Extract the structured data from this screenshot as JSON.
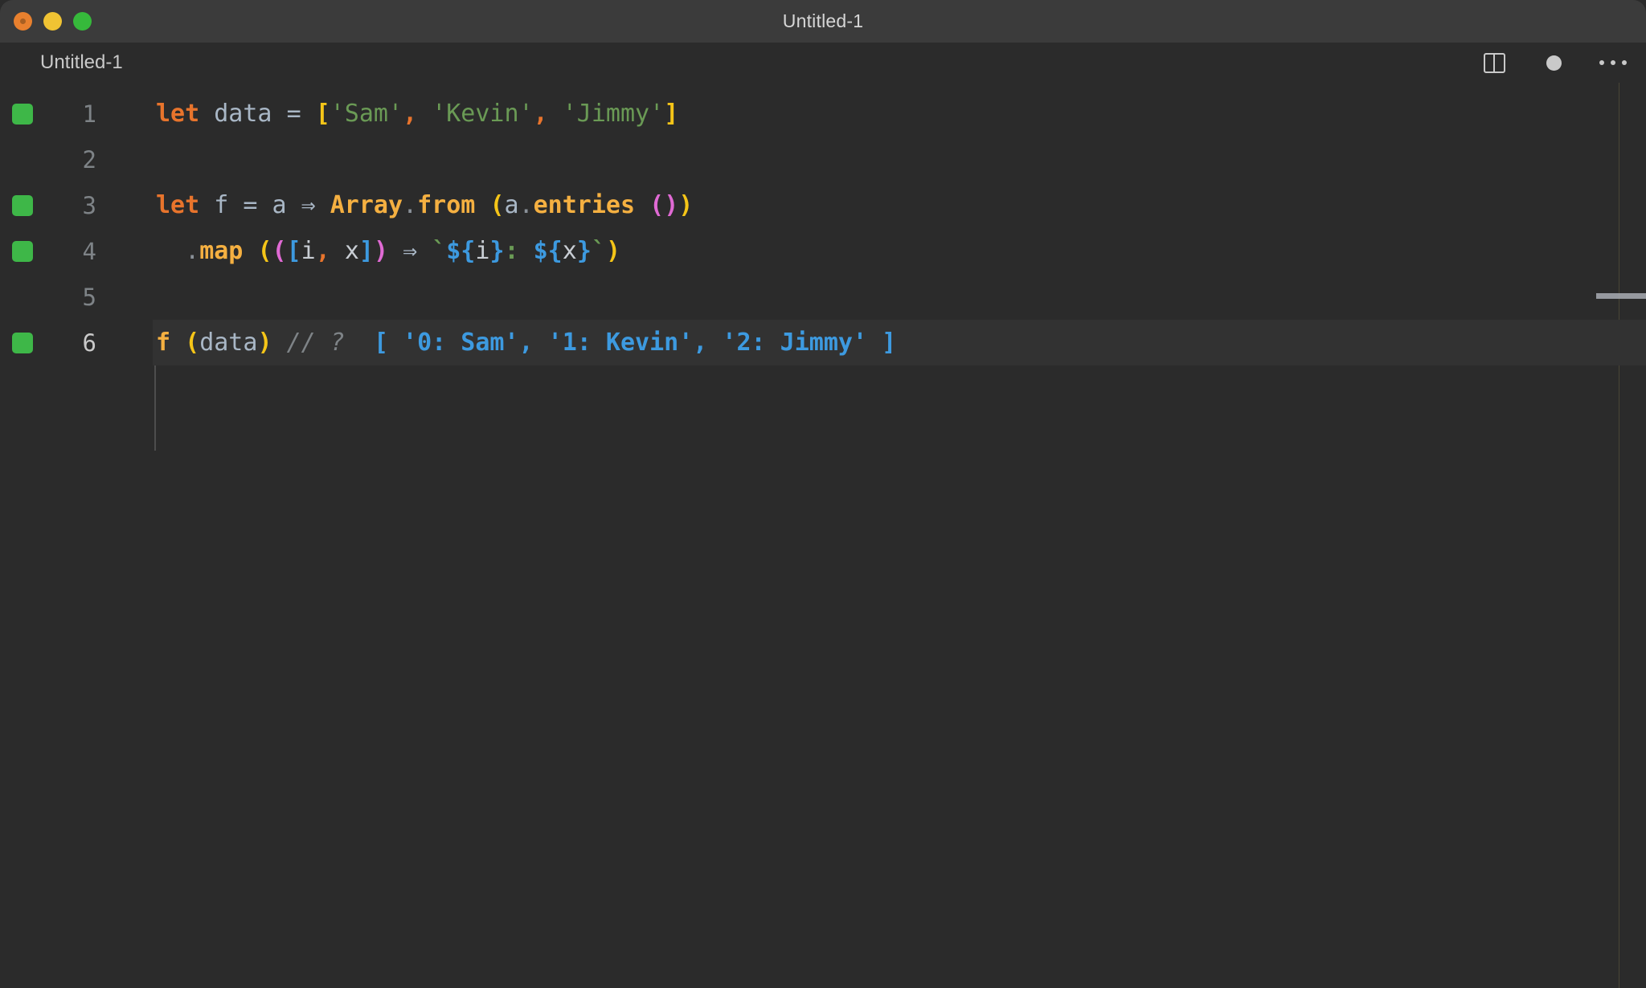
{
  "window": {
    "title": "Untitled-1",
    "traffic_lights": [
      {
        "name": "close",
        "color": "#e8802e"
      },
      {
        "name": "minimize",
        "color": "#f0c333"
      },
      {
        "name": "maximize",
        "color": "#36b93b"
      }
    ]
  },
  "tabstrip": {
    "tab_label": "Untitled-1",
    "actions": [
      {
        "icon": "split-editor-icon"
      },
      {
        "icon": "unsaved-dot-icon"
      },
      {
        "icon": "more-actions-ellipsis-icon"
      }
    ]
  },
  "editor": {
    "language": "javascript",
    "active_line": 6,
    "lines": [
      {
        "number": "1",
        "marker": true,
        "text": "let data = ['Sam', 'Kevin', 'Jimmy']",
        "tokens": [
          {
            "t": "let",
            "c": "t-kw"
          },
          {
            "t": " ",
            "c": "t-plain-w"
          },
          {
            "t": "data",
            "c": "t-var"
          },
          {
            "t": " ",
            "c": "t-plain-w"
          },
          {
            "t": "=",
            "c": "t-op"
          },
          {
            "t": " ",
            "c": "t-plain-w"
          },
          {
            "t": "[",
            "c": "t-punct-y"
          },
          {
            "t": "'Sam'",
            "c": "t-str"
          },
          {
            "t": ",",
            "c": "t-comma"
          },
          {
            "t": " ",
            "c": "t-plain-w"
          },
          {
            "t": "'Kevin'",
            "c": "t-str"
          },
          {
            "t": ",",
            "c": "t-comma"
          },
          {
            "t": " ",
            "c": "t-plain-w"
          },
          {
            "t": "'Jimmy'",
            "c": "t-str"
          },
          {
            "t": "]",
            "c": "t-punct-y"
          }
        ]
      },
      {
        "number": "2",
        "marker": false,
        "text": "",
        "tokens": []
      },
      {
        "number": "3",
        "marker": true,
        "text": "let f = a ⇒ Array.from (a.entries ())",
        "tokens": [
          {
            "t": "let",
            "c": "t-kw"
          },
          {
            "t": " ",
            "c": "t-plain-w"
          },
          {
            "t": "f",
            "c": "t-var"
          },
          {
            "t": " ",
            "c": "t-plain-w"
          },
          {
            "t": "=",
            "c": "t-op"
          },
          {
            "t": " ",
            "c": "t-plain-w"
          },
          {
            "t": "a",
            "c": "t-var"
          },
          {
            "t": " ",
            "c": "t-plain-w"
          },
          {
            "t": "⇒",
            "c": "t-arrow"
          },
          {
            "t": " ",
            "c": "t-plain-w"
          },
          {
            "t": "Array",
            "c": "t-fn"
          },
          {
            "t": ".",
            "c": "t-dot"
          },
          {
            "t": "from",
            "c": "t-fn"
          },
          {
            "t": " ",
            "c": "t-plain-w"
          },
          {
            "t": "(",
            "c": "t-punct-y"
          },
          {
            "t": "a",
            "c": "t-var"
          },
          {
            "t": ".",
            "c": "t-dot"
          },
          {
            "t": "entries",
            "c": "t-fn"
          },
          {
            "t": " ",
            "c": "t-plain-w"
          },
          {
            "t": "(",
            "c": "t-paren-p"
          },
          {
            "t": ")",
            "c": "t-paren-p"
          },
          {
            "t": ")",
            "c": "t-punct-y"
          }
        ]
      },
      {
        "number": "4",
        "marker": true,
        "text": "  .map (([i, x]) ⇒ `${i}: ${x}`)",
        "tokens": [
          {
            "t": "  ",
            "c": "t-plain-w"
          },
          {
            "t": ".",
            "c": "t-dot"
          },
          {
            "t": "map",
            "c": "t-fn"
          },
          {
            "t": " ",
            "c": "t-plain-w"
          },
          {
            "t": "(",
            "c": "t-punct-y"
          },
          {
            "t": "(",
            "c": "t-paren-p"
          },
          {
            "t": "[",
            "c": "t-brk-b"
          },
          {
            "t": "i",
            "c": "t-ivar"
          },
          {
            "t": ",",
            "c": "t-comma"
          },
          {
            "t": " ",
            "c": "t-plain-w"
          },
          {
            "t": "x",
            "c": "t-ivar"
          },
          {
            "t": "]",
            "c": "t-brk-b"
          },
          {
            "t": ")",
            "c": "t-paren-p"
          },
          {
            "t": " ",
            "c": "t-plain-w"
          },
          {
            "t": "⇒",
            "c": "t-arrow"
          },
          {
            "t": " ",
            "c": "t-plain-w"
          },
          {
            "t": "`",
            "c": "t-tick"
          },
          {
            "t": "${",
            "c": "t-interp"
          },
          {
            "t": "i",
            "c": "t-ivar"
          },
          {
            "t": "}",
            "c": "t-interp"
          },
          {
            "t": ":",
            "c": "t-colon-g"
          },
          {
            "t": " ",
            "c": "t-plain-w"
          },
          {
            "t": "${",
            "c": "t-interp"
          },
          {
            "t": "x",
            "c": "t-ivar"
          },
          {
            "t": "}",
            "c": "t-interp"
          },
          {
            "t": "`",
            "c": "t-tick"
          },
          {
            "t": ")",
            "c": "t-punct-y"
          }
        ]
      },
      {
        "number": "5",
        "marker": false,
        "text": "",
        "tokens": []
      },
      {
        "number": "6",
        "marker": true,
        "text": "f (data) // ?  [ '0: Sam', '1: Kevin', '2: Jimmy' ]",
        "tokens": [
          {
            "t": "f",
            "c": "t-fn"
          },
          {
            "t": " ",
            "c": "t-plain-w"
          },
          {
            "t": "(",
            "c": "t-punct-y"
          },
          {
            "t": "data",
            "c": "t-var"
          },
          {
            "t": ")",
            "c": "t-punct-y"
          },
          {
            "t": " ",
            "c": "t-plain-w"
          },
          {
            "t": "// ?",
            "c": "t-comment"
          },
          {
            "t": "  ",
            "c": "t-plain-w"
          },
          {
            "t": "[ '0: Sam', '1: Kevin', '2: Jimmy' ]",
            "c": "t-result"
          }
        ]
      }
    ]
  },
  "colors": {
    "window_chrome": "#3b3b3b",
    "editor_background": "#2b2b2b",
    "active_line_background": "#323232",
    "gutter_marker": "#3eb748",
    "keyword": "#e8742c",
    "string": "#6a9a55",
    "function": "#f5b041",
    "bracket_yellow": "#f5c518",
    "bracket_pink": "#e06ad4",
    "bracket_blue": "#3d9ae0",
    "comment": "#7e8387",
    "result": "#3d9ae0",
    "ruler_line": "#4a4637"
  }
}
